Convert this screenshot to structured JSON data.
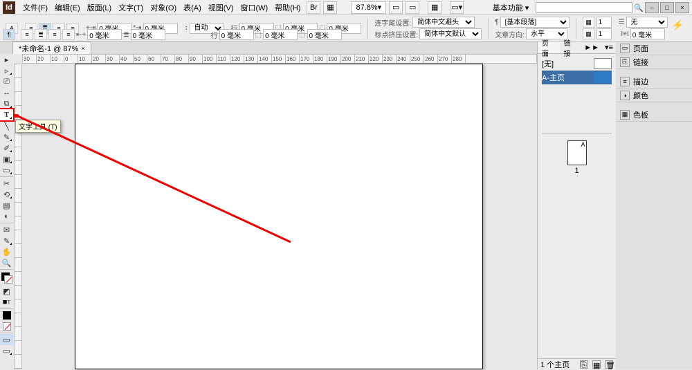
{
  "menubar": {
    "logo": "Id",
    "items": [
      "文件(F)",
      "编辑(E)",
      "版面(L)",
      "文字(T)",
      "对象(O)",
      "表(A)",
      "视图(V)",
      "窗口(W)",
      "帮助(H)"
    ],
    "zoom": "87.8%",
    "workspace": "基本功能",
    "search_placeholder": ""
  },
  "window_buttons": {
    "min": "–",
    "max": "□",
    "close": "×"
  },
  "controlbar": {
    "row1": {
      "char_icon": "A",
      "para_icon": "¶",
      "leading_field": "0 毫米",
      "tracking_field": "0 毫米",
      "align_label": "自动",
      "line_field": "0 毫米",
      "line_field2": "0 毫米",
      "glyph_field": "0 毫米",
      "anchor_label": "连字尾设置:",
      "anchor_value": "简体中文避头",
      "para_style_value": "[基本段落]",
      "grid_cols": "1",
      "span_value": "无",
      "span_field": "0 毫米"
    },
    "row2": {
      "leading2": "0 毫米",
      "tracking2": "0 毫米",
      "line2a": "0 毫米",
      "line2b": "0 毫米",
      "line2c": "0 毫米",
      "kinsoku_label": "标点挤压设置:",
      "kinsoku_value": "简体中文默认",
      "direction_label": "文章方向:",
      "direction_value": "水平",
      "grid_rows": "1"
    }
  },
  "doctab": {
    "label": "*未命名-1 @ 87%",
    "close": "×"
  },
  "h_ruler_ticks": [
    "30",
    "20",
    "10",
    "0",
    "10",
    "20",
    "30",
    "40",
    "50",
    "60",
    "70",
    "80",
    "90",
    "100",
    "110",
    "120",
    "130",
    "140",
    "150",
    "160",
    "170",
    "180",
    "190",
    "200",
    "210",
    "220",
    "230",
    "240",
    "250",
    "260",
    "270",
    "280"
  ],
  "tooltip": "文字工具 (T)",
  "toolbox": {
    "selection": "▸",
    "direct": "▹",
    "page_tool": "⎚",
    "gap_tool": "↔",
    "content_collector": "⧉",
    "type_tool": "T",
    "line_tool": "╲",
    "pen_tool": "✎",
    "pencil": "✐",
    "frame_rect": "▣",
    "rect": "▭",
    "scissors": "✂",
    "free_transform": "⟲",
    "gradient_swatch": "▤",
    "gradient_feather": "◐",
    "note": "✉",
    "eyedropper": "✎",
    "hand": "✋",
    "zoom": "🔍",
    "fill_stroke": "■",
    "default_fs": "◩",
    "apply_color": "■",
    "apply_none": "□",
    "normal_view": "▭",
    "preview": "▭"
  },
  "pages_panel": {
    "tabs": [
      "页面",
      "链接"
    ],
    "more": "►►",
    "none_master": "[无]",
    "a_master": "A-主页",
    "page_letter": "A",
    "page_number": "1",
    "footer": "1 个主页",
    "footer_icons": [
      "⎘",
      "▦",
      "🗑"
    ]
  },
  "right_panels": [
    {
      "icon": "▭",
      "label": "页面"
    },
    {
      "icon": "⎘",
      "label": "链接"
    },
    {
      "sep": true
    },
    {
      "icon": "≡",
      "label": "描边"
    },
    {
      "icon": "◑",
      "label": "颜色"
    },
    {
      "sep": true
    },
    {
      "icon": "▦",
      "label": "色板"
    }
  ]
}
